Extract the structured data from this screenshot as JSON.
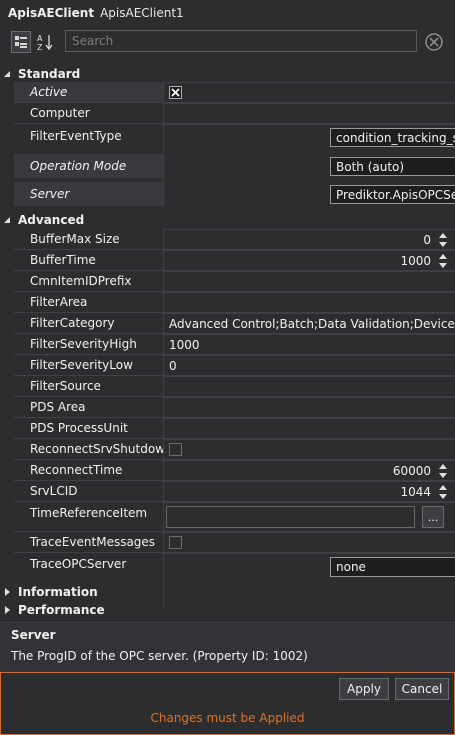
{
  "window": {
    "object_name": "ApisAEClient",
    "object_type": "ApisAEClient1"
  },
  "toolbar": {
    "search_placeholder": "Search"
  },
  "categories": {
    "standard": "Standard",
    "advanced": "Advanced",
    "information": "Information",
    "performance": "Performance"
  },
  "standard": {
    "active": {
      "name": "Active",
      "checked": true
    },
    "computer": {
      "name": "Computer",
      "value": ""
    },
    "filter_event_type": {
      "name": "FilterEventType",
      "value": "condition_tracking_simple"
    },
    "operation_mode": {
      "name": "Operation Mode",
      "value": "Both (auto)"
    },
    "server": {
      "name": "Server",
      "value": "Prediktor.ApisOPCServer.APIS_OPCAE_SERVER"
    }
  },
  "advanced": {
    "buffer_max_size": {
      "name": "BufferMax Size",
      "value": "0"
    },
    "buffer_time": {
      "name": "BufferTime",
      "value": "1000"
    },
    "cmn_item_id_prefix": {
      "name": "CmnItemIDPrefix",
      "value": ""
    },
    "filter_area": {
      "name": "FilterArea",
      "value": ""
    },
    "filter_category": {
      "name": "FilterCategory",
      "value": "Advanced Control;Batch;Data  Validation;Device;Discre"
    },
    "filter_severity_high": {
      "name": "FilterSeverityHigh",
      "value": "1000"
    },
    "filter_severity_low": {
      "name": "FilterSeverityLow",
      "value": "0"
    },
    "filter_source": {
      "name": "FilterSource",
      "value": ""
    },
    "pds_area": {
      "name": "PDS Area",
      "value": ""
    },
    "pds_process_unit": {
      "name": "PDS ProcessUnit",
      "value": ""
    },
    "reconnect_srv_shutdown": {
      "name": "ReconnectSrvShutdown",
      "checked": false
    },
    "reconnect_time": {
      "name": "ReconnectTime",
      "value": "60000"
    },
    "srv_lcid": {
      "name": "SrvLCID",
      "value": "1044"
    },
    "time_reference_item": {
      "name": "TimeReferenceItem",
      "value": "",
      "button": "..."
    },
    "trace_event_messages": {
      "name": "TraceEventMessages",
      "checked": false
    },
    "trace_opc_server": {
      "name": "TraceOPCServer",
      "value": "none"
    }
  },
  "description": {
    "title": "Server",
    "text": "The ProgID of the OPC server. (Property ID: 1002)"
  },
  "footer": {
    "apply_label": "Apply",
    "cancel_label": "Cancel",
    "message": "Changes must be Applied"
  },
  "colors": {
    "background": "#2d2d30",
    "accent": "#d86b2a",
    "grid_line": "#3f3f46"
  }
}
